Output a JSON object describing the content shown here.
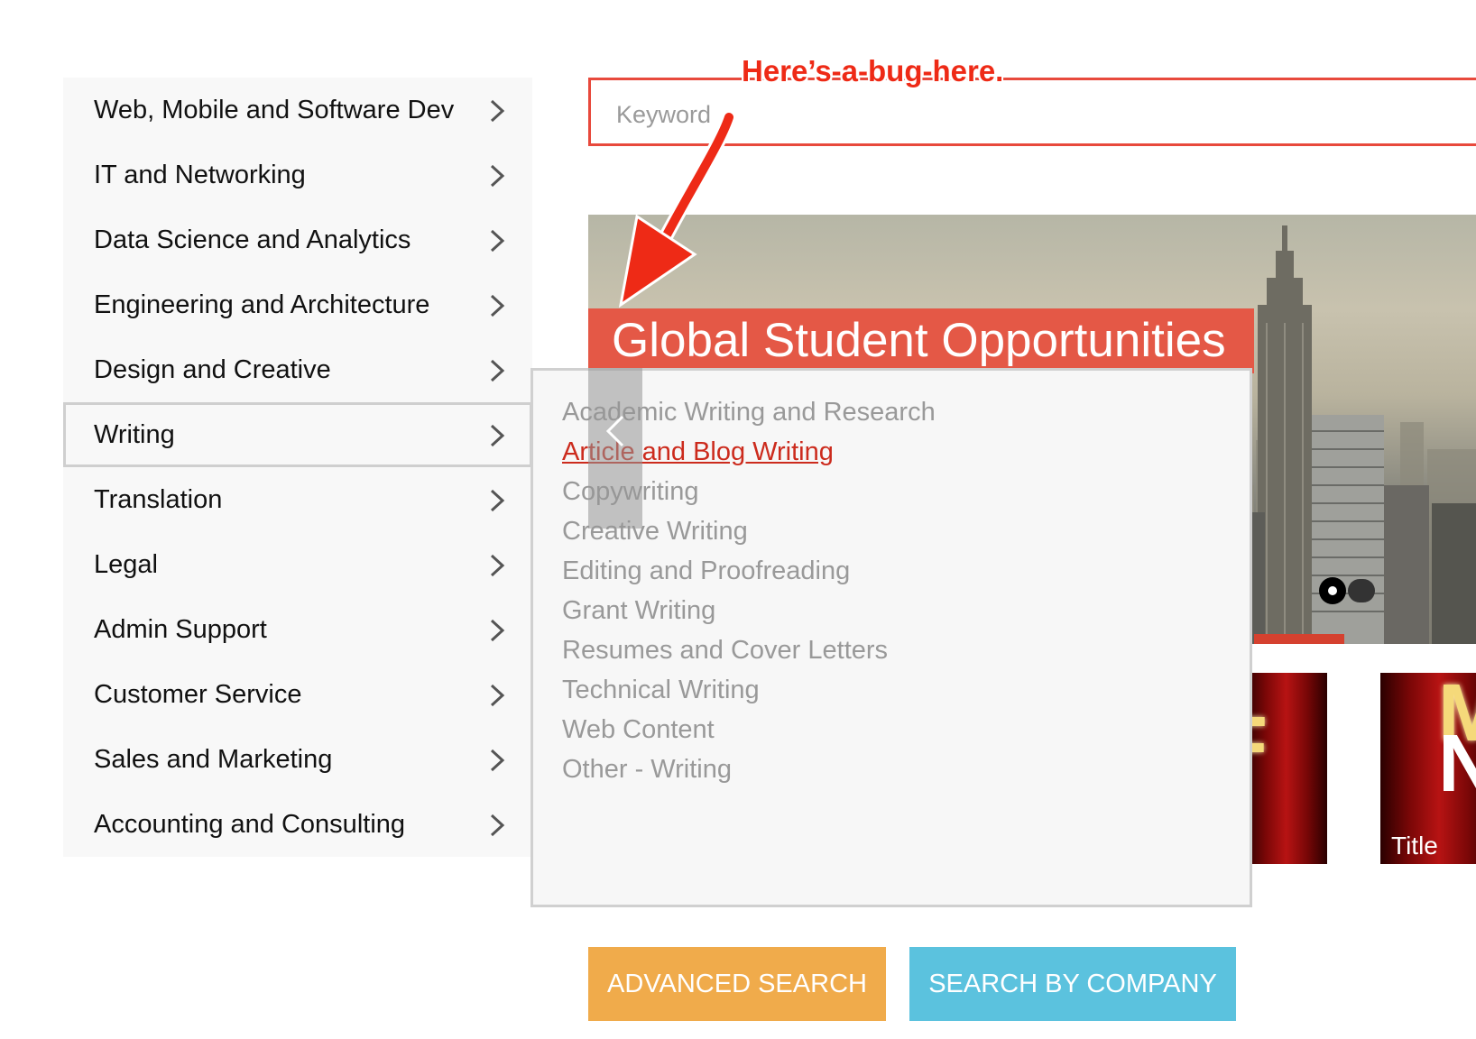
{
  "sidebar": {
    "items": [
      {
        "label": "Web, Mobile and Software Dev"
      },
      {
        "label": "IT and Networking"
      },
      {
        "label": "Data Science and Analytics"
      },
      {
        "label": "Engineering and Architecture"
      },
      {
        "label": "Design and Creative"
      },
      {
        "label": "Writing"
      },
      {
        "label": "Translation"
      },
      {
        "label": "Legal"
      },
      {
        "label": "Admin Support"
      },
      {
        "label": "Customer Service"
      },
      {
        "label": "Sales and Marketing"
      },
      {
        "label": "Accounting and Consulting"
      }
    ],
    "active_index": 5,
    "chevron_icon": "chevron-right-icon"
  },
  "search": {
    "placeholder": "Keyword",
    "value": "",
    "border_color": "#e8493c"
  },
  "annotation": {
    "text": "Here’s-a-bug-here.",
    "color": "#ee2a16"
  },
  "hero": {
    "title": "Global Student Opportunities",
    "title_bg": "#e45846"
  },
  "submenu": {
    "items": [
      {
        "label": "Academic Writing and Research"
      },
      {
        "label": "Article and Blog Writing"
      },
      {
        "label": "Copywriting"
      },
      {
        "label": "Creative Writing"
      },
      {
        "label": "Editing and Proofreading"
      },
      {
        "label": "Grant Writing"
      },
      {
        "label": "Resumes and Cover Letters"
      },
      {
        "label": "Technical Writing"
      },
      {
        "label": "Web Content"
      },
      {
        "label": "Other - Writing"
      }
    ],
    "selected_index": 1
  },
  "thumbnails": [
    {
      "title": ""
    },
    {
      "title": "Title"
    }
  ],
  "buttons": {
    "advanced_search": "ADVANCED SEARCH",
    "search_by_company": "SEARCH BY COMPANY",
    "advanced_color": "#f0ab4b",
    "company_color": "#5bc2de"
  }
}
